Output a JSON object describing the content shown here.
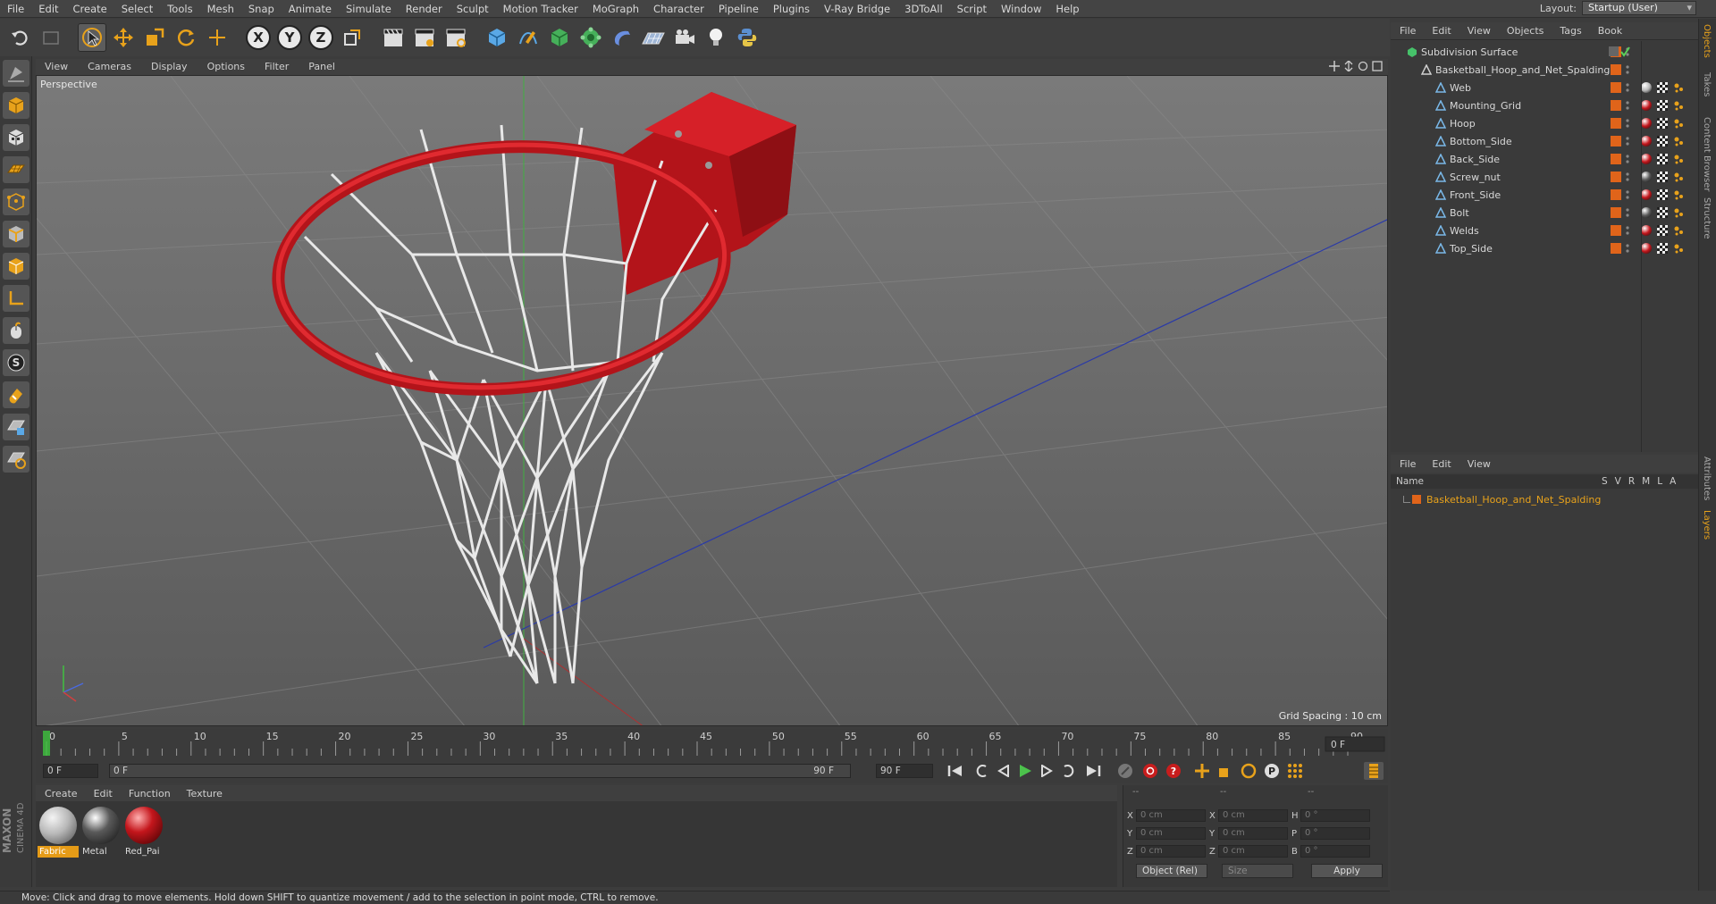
{
  "menubar": {
    "items": [
      "File",
      "Edit",
      "Create",
      "Select",
      "Tools",
      "Mesh",
      "Snap",
      "Animate",
      "Simulate",
      "Render",
      "Sculpt",
      "Motion Tracker",
      "MoGraph",
      "Character",
      "Pipeline",
      "Plugins",
      "V-Ray Bridge",
      "3DToAll",
      "Script",
      "Window",
      "Help"
    ],
    "layout_label": "Layout:",
    "layout_value": "Startup (User)"
  },
  "viewport": {
    "menu": [
      "View",
      "Cameras",
      "Display",
      "Options",
      "Filter",
      "Panel"
    ],
    "label": "Perspective",
    "grid_spacing": "Grid Spacing : 10 cm"
  },
  "timeline": {
    "ticks": [
      "0",
      "5",
      "10",
      "15",
      "20",
      "25",
      "30",
      "35",
      "40",
      "45",
      "50",
      "55",
      "60",
      "65",
      "70",
      "75",
      "80",
      "85",
      "90"
    ],
    "current_frame": "0 F",
    "start_field": "0 F",
    "range_start": "0 F",
    "range_end": "90 F",
    "end_field": "90 F"
  },
  "materials": {
    "menu": [
      "Create",
      "Edit",
      "Function",
      "Texture"
    ],
    "items": [
      {
        "label": "Fabric",
        "color": "#b8b8b8"
      },
      {
        "label": "Metal",
        "color": "#5a5a5a"
      },
      {
        "label": "Red_Pai",
        "color": "#c4161c"
      }
    ]
  },
  "coordinates": {
    "header": [
      "--",
      "--",
      "--"
    ],
    "rows": [
      {
        "a": "X",
        "av": "0 cm",
        "b": "X",
        "bv": "0 cm",
        "c": "H",
        "cv": "0 °"
      },
      {
        "a": "Y",
        "av": "0 cm",
        "b": "Y",
        "bv": "0 cm",
        "c": "P",
        "cv": "0 °"
      },
      {
        "a": "Z",
        "av": "0 cm",
        "b": "Z",
        "bv": "0 cm",
        "c": "B",
        "cv": "0 °"
      }
    ],
    "mode": "Object (Rel)",
    "size": "Size",
    "apply": "Apply"
  },
  "status": "Move: Click and drag to move elements. Hold down SHIFT to quantize movement / add to the selection in point mode, CTRL to remove.",
  "object_manager": {
    "menu": [
      "File",
      "Edit",
      "View",
      "Objects",
      "Tags",
      "Book"
    ],
    "root": "Subdivision Surface",
    "group": "Basketball_Hoop_and_Net_Spalding",
    "children": [
      "Web",
      "Mounting_Grid",
      "Hoop",
      "Bottom_Side",
      "Back_Side",
      "Screw_nut",
      "Front_Side",
      "Bolt",
      "Welds",
      "Top_Side"
    ],
    "child_material": [
      "#b8b8b8",
      "#c4161c",
      "#c4161c",
      "#c4161c",
      "#c4161c",
      "#5a5a5a",
      "#c4161c",
      "#5a5a5a",
      "#c4161c",
      "#c4161c"
    ]
  },
  "layer_manager": {
    "menu": [
      "File",
      "Edit",
      "View"
    ],
    "header_name": "Name",
    "header_cols": [
      "S",
      "V",
      "R",
      "M",
      "L",
      "A"
    ],
    "layer": "Basketball_Hoop_and_Net_Spalding"
  },
  "right_tabs": [
    "Objects",
    "Takes",
    "Content Browser",
    "Structure",
    "Attributes",
    "Layers"
  ]
}
